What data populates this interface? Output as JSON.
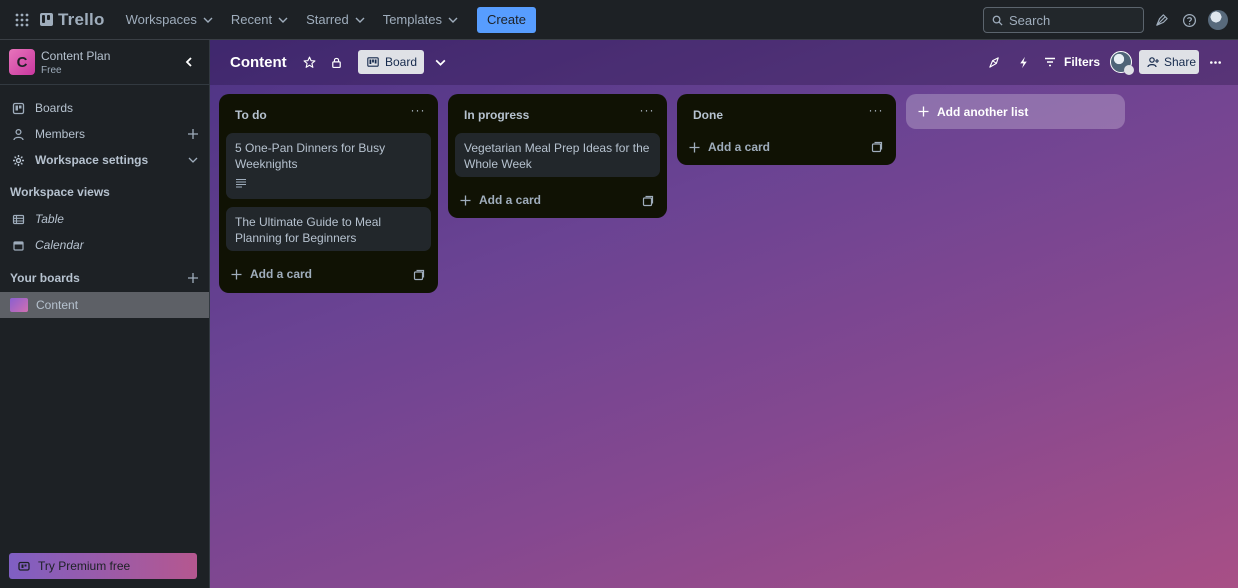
{
  "topbar": {
    "brand": "Trello",
    "nav": [
      {
        "label": "Workspaces"
      },
      {
        "label": "Recent"
      },
      {
        "label": "Starred"
      },
      {
        "label": "Templates"
      }
    ],
    "create_label": "Create",
    "search_placeholder": "Search",
    "icons": [
      "app-switcher-icon",
      "notifications-icon",
      "help-icon",
      "account-avatar"
    ]
  },
  "sidebar": {
    "workspace_initial": "C",
    "workspace_name": "Content Plan",
    "workspace_plan": "Free",
    "items": [
      {
        "label": "Boards",
        "icon": "board-icon"
      },
      {
        "label": "Members",
        "icon": "person-icon"
      },
      {
        "label": "Workspace settings",
        "icon": "gear-icon"
      }
    ],
    "views_heading": "Workspace views",
    "views": [
      {
        "label": "Table",
        "icon": "table-icon"
      },
      {
        "label": "Calendar",
        "icon": "calendar-icon"
      }
    ],
    "boards_heading": "Your boards",
    "boards": [
      {
        "label": "Content",
        "active": true
      }
    ],
    "premium_label": "Try Premium free"
  },
  "board": {
    "title": "Content",
    "view_label": "Board",
    "filters_label": "Filters",
    "share_label": "Share",
    "lists": [
      {
        "title": "To do",
        "cards": [
          {
            "title": "5 One-Pan Dinners for Busy Weeknights",
            "has_description": true
          },
          {
            "title": "The Ultimate Guide to Meal Planning for Beginners",
            "has_description": false
          }
        ],
        "add_card_label": "Add a card"
      },
      {
        "title": "In progress",
        "cards": [
          {
            "title": "Vegetarian Meal Prep Ideas for the Whole Week",
            "has_description": false
          }
        ],
        "add_card_label": "Add a card"
      },
      {
        "title": "Done",
        "cards": [],
        "add_card_label": "Add a card"
      }
    ],
    "add_list_label": "Add another list"
  },
  "colors": {
    "create_button": "#579dff",
    "workspace_badge": "#e774bb",
    "list_background": "#101204",
    "card_background": "#22272b"
  }
}
